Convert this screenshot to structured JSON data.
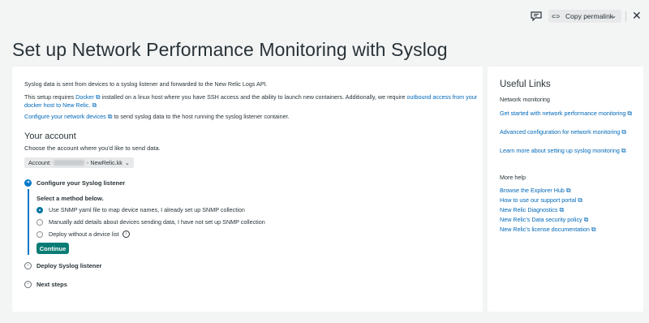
{
  "topbar": {
    "permalink_label": "Copy permalink",
    "link_glyph": "⊂⊃",
    "chevron": "⌄",
    "close": "✕"
  },
  "page_title": "Set up Network Performance Monitoring with Syslog",
  "intro": {
    "p1": "Syslog data is sent from devices to a syslog listener and forwarded to the New Relic Logs API.",
    "p2_a": "This setup requires ",
    "p2_docker": "Docker",
    "p2_b": " installed on a linux host where you have SSH access and the ability to launch new containers. Additionally, we require ",
    "p2_outbound": "outbound access from your docker host to New Relic.",
    "p3_link": "Configure your network devices",
    "p3_b": " to send syslog data to the host running the syslog listener container.",
    "ext_glyph": "⧉"
  },
  "account": {
    "title": "Your account",
    "subtitle": "Choose the account where you'd like to send data.",
    "prefix": "Account:",
    "suffix": "- NewRelic.kk",
    "chevron": "⌄"
  },
  "steps": {
    "step1": "Configure your Syslog listener",
    "method_title": "Select a method below.",
    "options": [
      "Use SNMP yaml file to map device names, I already set up SNMP collection",
      "Manually add details about devices sending data, I have not set up SNMP collection",
      "Deploy without a device list"
    ],
    "selected_index": 0,
    "info_glyph": "i",
    "continue": "Continue",
    "step2": "Deploy Syslog listener",
    "step3": "Next steps",
    "check_glyph": "✓",
    "arrow_glyph": "➜"
  },
  "side": {
    "title": "Useful Links",
    "heading1": "Network monitoring",
    "links1": [
      "Get started with network performance monitoring",
      "Advanced configuration for network monitoring",
      "Learn more about setting up syslog monitoring"
    ],
    "heading2": "More help",
    "links2": [
      "Browse the Explorer Hub",
      "How to use our support portal",
      "New Relic Diagnostics",
      "New Relic's Data security policy",
      "New Relic's license documentation"
    ]
  }
}
